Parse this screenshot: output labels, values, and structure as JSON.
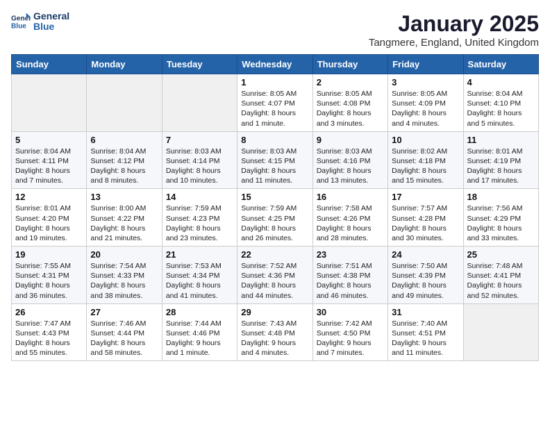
{
  "logo": {
    "line1": "General",
    "line2": "Blue"
  },
  "header": {
    "title": "January 2025",
    "location": "Tangmere, England, United Kingdom"
  },
  "weekdays": [
    "Sunday",
    "Monday",
    "Tuesday",
    "Wednesday",
    "Thursday",
    "Friday",
    "Saturday"
  ],
  "weeks": [
    [
      {
        "day": "",
        "info": ""
      },
      {
        "day": "",
        "info": ""
      },
      {
        "day": "",
        "info": ""
      },
      {
        "day": "1",
        "info": "Sunrise: 8:05 AM\nSunset: 4:07 PM\nDaylight: 8 hours\nand 1 minute."
      },
      {
        "day": "2",
        "info": "Sunrise: 8:05 AM\nSunset: 4:08 PM\nDaylight: 8 hours\nand 3 minutes."
      },
      {
        "day": "3",
        "info": "Sunrise: 8:05 AM\nSunset: 4:09 PM\nDaylight: 8 hours\nand 4 minutes."
      },
      {
        "day": "4",
        "info": "Sunrise: 8:04 AM\nSunset: 4:10 PM\nDaylight: 8 hours\nand 5 minutes."
      }
    ],
    [
      {
        "day": "5",
        "info": "Sunrise: 8:04 AM\nSunset: 4:11 PM\nDaylight: 8 hours\nand 7 minutes."
      },
      {
        "day": "6",
        "info": "Sunrise: 8:04 AM\nSunset: 4:12 PM\nDaylight: 8 hours\nand 8 minutes."
      },
      {
        "day": "7",
        "info": "Sunrise: 8:03 AM\nSunset: 4:14 PM\nDaylight: 8 hours\nand 10 minutes."
      },
      {
        "day": "8",
        "info": "Sunrise: 8:03 AM\nSunset: 4:15 PM\nDaylight: 8 hours\nand 11 minutes."
      },
      {
        "day": "9",
        "info": "Sunrise: 8:03 AM\nSunset: 4:16 PM\nDaylight: 8 hours\nand 13 minutes."
      },
      {
        "day": "10",
        "info": "Sunrise: 8:02 AM\nSunset: 4:18 PM\nDaylight: 8 hours\nand 15 minutes."
      },
      {
        "day": "11",
        "info": "Sunrise: 8:01 AM\nSunset: 4:19 PM\nDaylight: 8 hours\nand 17 minutes."
      }
    ],
    [
      {
        "day": "12",
        "info": "Sunrise: 8:01 AM\nSunset: 4:20 PM\nDaylight: 8 hours\nand 19 minutes."
      },
      {
        "day": "13",
        "info": "Sunrise: 8:00 AM\nSunset: 4:22 PM\nDaylight: 8 hours\nand 21 minutes."
      },
      {
        "day": "14",
        "info": "Sunrise: 7:59 AM\nSunset: 4:23 PM\nDaylight: 8 hours\nand 23 minutes."
      },
      {
        "day": "15",
        "info": "Sunrise: 7:59 AM\nSunset: 4:25 PM\nDaylight: 8 hours\nand 26 minutes."
      },
      {
        "day": "16",
        "info": "Sunrise: 7:58 AM\nSunset: 4:26 PM\nDaylight: 8 hours\nand 28 minutes."
      },
      {
        "day": "17",
        "info": "Sunrise: 7:57 AM\nSunset: 4:28 PM\nDaylight: 8 hours\nand 30 minutes."
      },
      {
        "day": "18",
        "info": "Sunrise: 7:56 AM\nSunset: 4:29 PM\nDaylight: 8 hours\nand 33 minutes."
      }
    ],
    [
      {
        "day": "19",
        "info": "Sunrise: 7:55 AM\nSunset: 4:31 PM\nDaylight: 8 hours\nand 36 minutes."
      },
      {
        "day": "20",
        "info": "Sunrise: 7:54 AM\nSunset: 4:33 PM\nDaylight: 8 hours\nand 38 minutes."
      },
      {
        "day": "21",
        "info": "Sunrise: 7:53 AM\nSunset: 4:34 PM\nDaylight: 8 hours\nand 41 minutes."
      },
      {
        "day": "22",
        "info": "Sunrise: 7:52 AM\nSunset: 4:36 PM\nDaylight: 8 hours\nand 44 minutes."
      },
      {
        "day": "23",
        "info": "Sunrise: 7:51 AM\nSunset: 4:38 PM\nDaylight: 8 hours\nand 46 minutes."
      },
      {
        "day": "24",
        "info": "Sunrise: 7:50 AM\nSunset: 4:39 PM\nDaylight: 8 hours\nand 49 minutes."
      },
      {
        "day": "25",
        "info": "Sunrise: 7:48 AM\nSunset: 4:41 PM\nDaylight: 8 hours\nand 52 minutes."
      }
    ],
    [
      {
        "day": "26",
        "info": "Sunrise: 7:47 AM\nSunset: 4:43 PM\nDaylight: 8 hours\nand 55 minutes."
      },
      {
        "day": "27",
        "info": "Sunrise: 7:46 AM\nSunset: 4:44 PM\nDaylight: 8 hours\nand 58 minutes."
      },
      {
        "day": "28",
        "info": "Sunrise: 7:44 AM\nSunset: 4:46 PM\nDaylight: 9 hours\nand 1 minute."
      },
      {
        "day": "29",
        "info": "Sunrise: 7:43 AM\nSunset: 4:48 PM\nDaylight: 9 hours\nand 4 minutes."
      },
      {
        "day": "30",
        "info": "Sunrise: 7:42 AM\nSunset: 4:50 PM\nDaylight: 9 hours\nand 7 minutes."
      },
      {
        "day": "31",
        "info": "Sunrise: 7:40 AM\nSunset: 4:51 PM\nDaylight: 9 hours\nand 11 minutes."
      },
      {
        "day": "",
        "info": ""
      }
    ]
  ]
}
